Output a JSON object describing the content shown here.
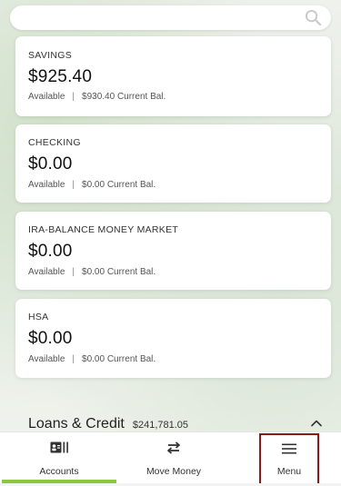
{
  "search": {
    "icon": "search-icon"
  },
  "accounts": [
    {
      "name": "SAVINGS",
      "amount": "$925.40",
      "available": "Available",
      "separator": "|",
      "current": "$930.40 Current Bal."
    },
    {
      "name": "CHECKING",
      "amount": "$0.00",
      "available": "Available",
      "separator": "|",
      "current": "$0.00 Current Bal."
    },
    {
      "name": "IRA-BALANCE MONEY MARKET",
      "amount": "$0.00",
      "available": "Available",
      "separator": "|",
      "current": "$0.00 Current Bal."
    },
    {
      "name": "HSA",
      "amount": "$0.00",
      "available": "Available",
      "separator": "|",
      "current": "$0.00 Current Bal."
    }
  ],
  "loans": {
    "title": "Loans & Credit",
    "total": "$241,781.05",
    "icon": "chevron-up-icon"
  },
  "nav": {
    "accounts": {
      "label": "Accounts",
      "icon": "accounts-icon",
      "active": true
    },
    "move_money": {
      "label": "Move Money",
      "icon": "transfer-arrows-icon"
    },
    "menu": {
      "label": "Menu",
      "icon": "hamburger-icon"
    }
  },
  "colors": {
    "active_indicator": "#8cc63f",
    "menu_highlight_border": "#8b1a1a"
  }
}
